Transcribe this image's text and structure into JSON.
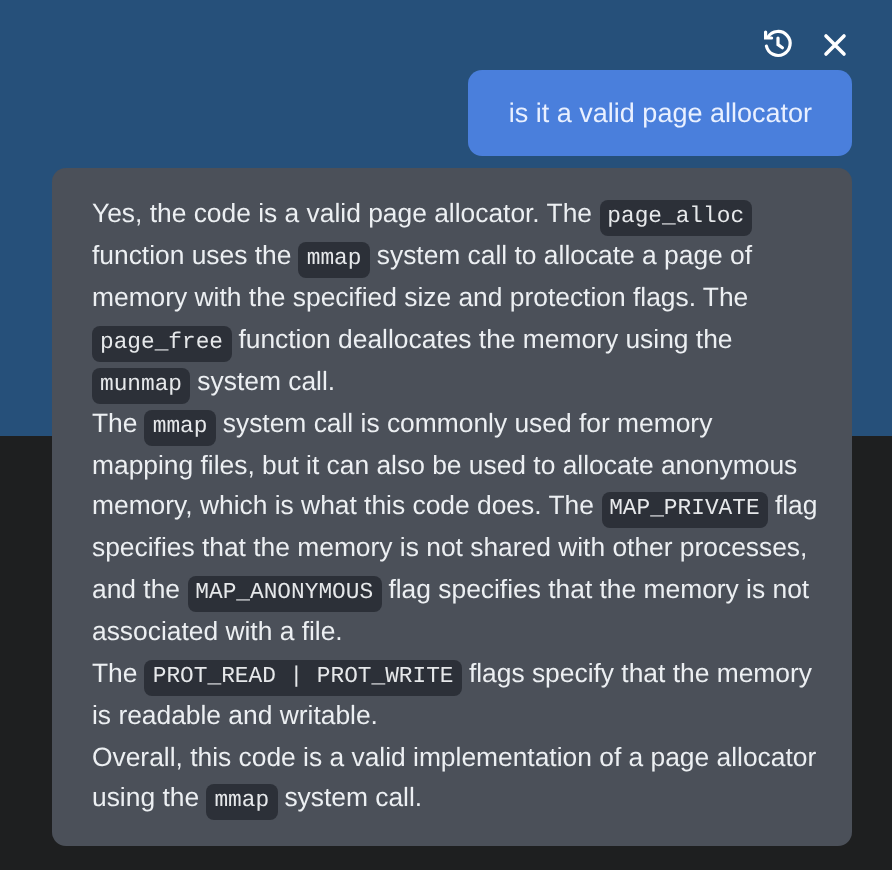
{
  "toolbar": {
    "buttons": [
      {
        "kind": "history"
      },
      {
        "kind": "close"
      }
    ]
  },
  "messages": [
    {
      "kind": "question",
      "text": "is it a valid page allocator"
    },
    {
      "kind": "answer",
      "paragraphs": [
        [
          {
            "text": "Yes, the code is a valid page allocator. The "
          },
          {
            "text": "page_alloc",
            "kind": "code"
          },
          {
            "text": " function uses the "
          },
          {
            "text": "mmap",
            "kind": "code"
          },
          {
            "text": " system call to allocate a page of memory with the specified size and protection flags. The "
          },
          {
            "text": "page_free",
            "kind": "code"
          },
          {
            "text": " function deallocates the memory using the "
          },
          {
            "text": "munmap",
            "kind": "code"
          },
          {
            "text": " system call."
          }
        ],
        [
          {
            "text": "The "
          },
          {
            "text": "mmap",
            "kind": "code"
          },
          {
            "text": " system call is commonly used for memory mapping files, but it can also be used to allocate anonymous memory, which is what this code does. The "
          },
          {
            "text": "MAP_PRIVATE",
            "kind": "code"
          },
          {
            "text": " flag specifies that the memory is not shared with other processes, and the "
          },
          {
            "text": "MAP_ANONYMOUS",
            "kind": "code"
          },
          {
            "text": " flag specifies that the memory is not associated with a file."
          }
        ],
        [
          {
            "text": "The "
          },
          {
            "text": "PROT_READ | PROT_WRITE",
            "kind": "code"
          },
          {
            "text": " flags specify that the memory is readable and writable."
          }
        ],
        [
          {
            "text": "Overall, this code is a valid implementation of a page allocator using the "
          },
          {
            "text": "mmap",
            "kind": "code"
          },
          {
            "text": " system call."
          }
        ]
      ]
    }
  ]
}
